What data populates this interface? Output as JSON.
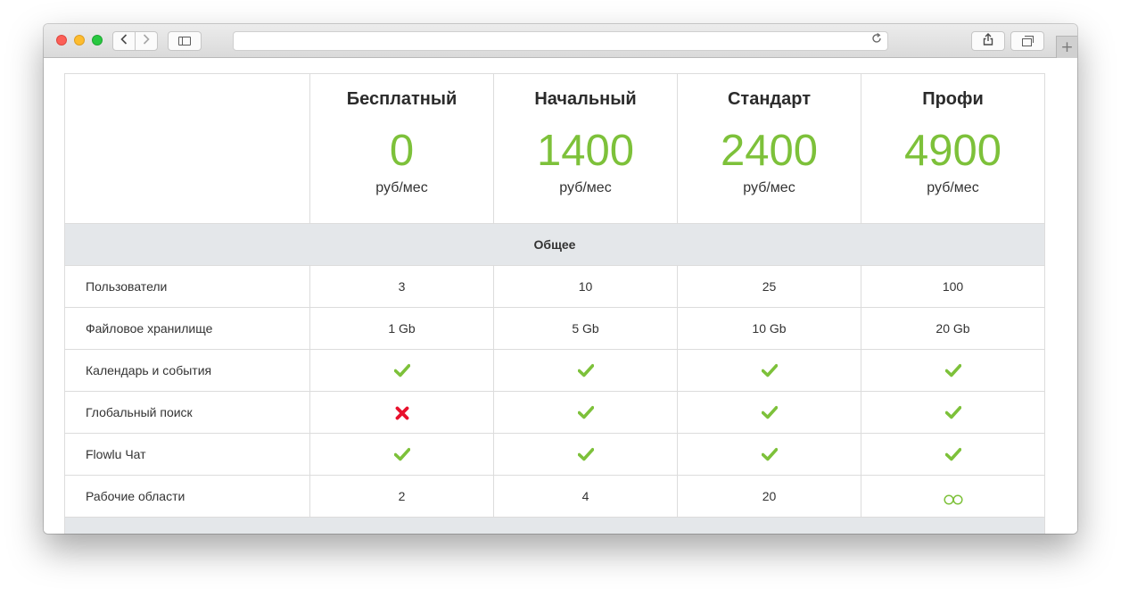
{
  "browser": {
    "back_icon": "chevron-left-icon",
    "forward_icon": "chevron-right-icon",
    "sidebar_icon": "sidebar-icon",
    "share_icon": "share-icon",
    "tabs_icon": "tabs-icon",
    "reload_icon": "reload-icon",
    "new_tab_icon": "plus-icon",
    "address_value": ""
  },
  "plans": [
    {
      "name": "Бесплатный",
      "price": "0",
      "unit": "руб/мес"
    },
    {
      "name": "Начальный",
      "price": "1400",
      "unit": "руб/мес"
    },
    {
      "name": "Стандарт",
      "price": "2400",
      "unit": "руб/мес"
    },
    {
      "name": "Профи",
      "price": "4900",
      "unit": "руб/мес"
    }
  ],
  "section": {
    "title": "Общее"
  },
  "features": [
    {
      "name": "Пользователи",
      "values": [
        "3",
        "10",
        "25",
        "100"
      ]
    },
    {
      "name": "Файловое хранилище",
      "values": [
        "1 Gb",
        "5 Gb",
        "10 Gb",
        "20 Gb"
      ]
    },
    {
      "name": "Календарь и события",
      "values": [
        "check-icon",
        "check-icon",
        "check-icon",
        "check-icon"
      ]
    },
    {
      "name": "Глобальный поиск",
      "values": [
        "cross-icon",
        "check-icon",
        "check-icon",
        "check-icon"
      ]
    },
    {
      "name": "Flowlu Чат",
      "values": [
        "check-icon",
        "check-icon",
        "check-icon",
        "check-icon"
      ]
    },
    {
      "name": "Рабочие области",
      "values": [
        "2",
        "4",
        "20",
        "infinity-icon"
      ]
    }
  ],
  "colors": {
    "accent_green": "#7dc13a",
    "cross_red": "#e8112d",
    "section_bg": "#e4e7ea"
  }
}
